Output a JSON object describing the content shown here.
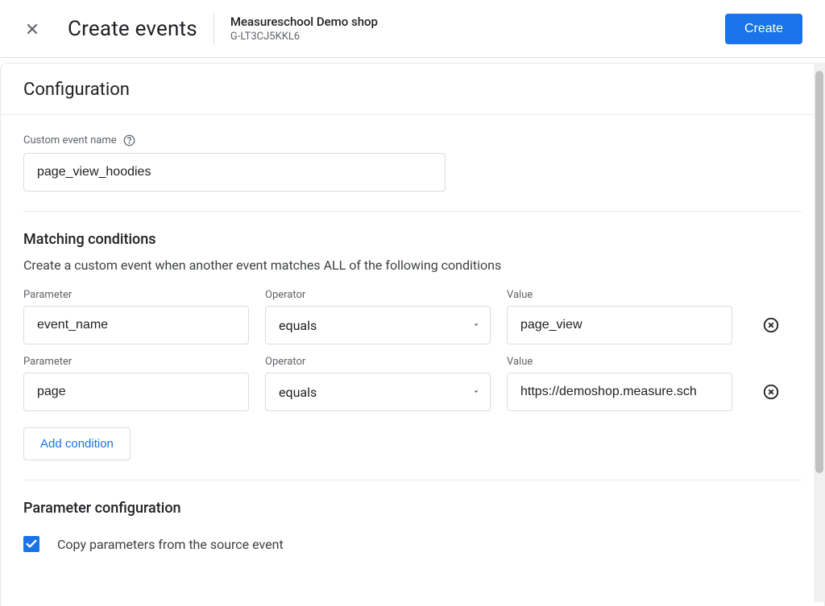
{
  "header": {
    "title": "Create events",
    "shop_name": "Measureschool Demo shop",
    "shop_id": "G-LT3CJ5KKL6",
    "create_button": "Create"
  },
  "config": {
    "title": "Configuration",
    "custom_event_label": "Custom event name",
    "custom_event_value": "page_view_hoodies"
  },
  "matching": {
    "title": "Matching conditions",
    "description": "Create a custom event when another event matches ALL of the following conditions",
    "labels": {
      "parameter": "Parameter",
      "operator": "Operator",
      "value": "Value"
    },
    "conditions": [
      {
        "parameter": "event_name",
        "operator": "equals",
        "value": "page_view"
      },
      {
        "parameter": "page",
        "operator": "equals",
        "value": "https://demoshop.measure.sch"
      }
    ],
    "add_condition": "Add condition"
  },
  "param_config": {
    "title": "Parameter configuration",
    "copy_label": "Copy parameters from the source event",
    "copy_checked": true
  }
}
